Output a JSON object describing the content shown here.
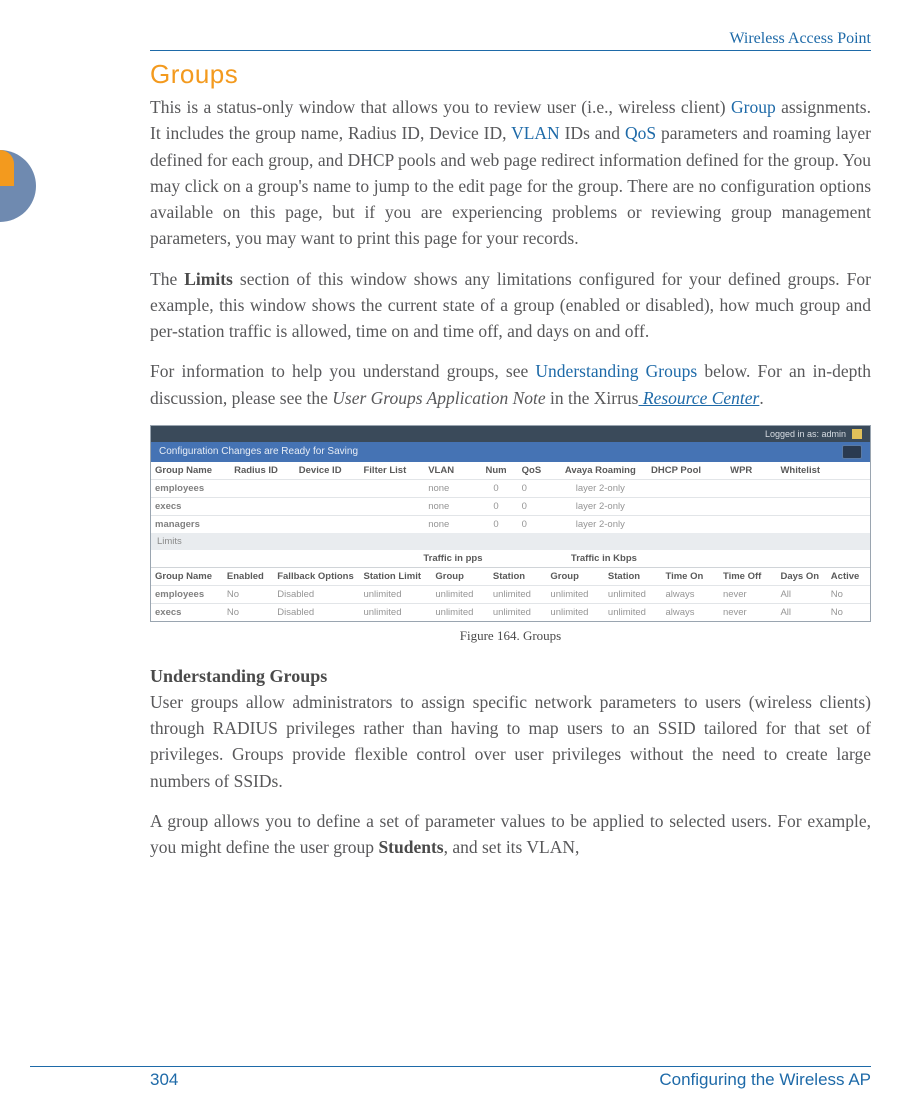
{
  "header": {
    "running_title": "Wireless Access Point"
  },
  "section": {
    "title": "Groups"
  },
  "para1": {
    "t1": "This is a status-only window that allows you to review user (i.e., wireless client) ",
    "l1": "Group",
    "t2": " assignments. It includes the group name, Radius ID, Device ID, ",
    "l2": "VLAN",
    "t3": " IDs and ",
    "l3": "QoS",
    "t4": " parameters and roaming layer defined for each group, and DHCP pools and web page redirect information defined for the group. You may click on a group's name to jump to the edit page for the group. There are no configuration options available on this page, but if you are experiencing problems or reviewing group management parameters, you may want to print this page for your records."
  },
  "para2": {
    "t1": "The ",
    "b1": "Limits",
    "t2": " section of this window shows any limitations configured for your defined groups. For example, this window shows the current state of a group (enabled or disabled), how much group and per-station traffic is allowed, time on and time off, and days on and off."
  },
  "para3": {
    "t1": "For information to help you understand groups, see ",
    "l1": "Understanding Groups",
    "t2": " below. For an in-depth discussion, please see the ",
    "i1": "User Groups Application Note",
    "t3": " in the Xirrus",
    "l2": " Resource Center",
    "t4": "."
  },
  "figure": {
    "caption": "Figure 164. Groups",
    "login": "Logged in as: admin",
    "config_banner": "Configuration Changes are Ready for Saving",
    "t1": {
      "headers": [
        "Group Name",
        "Radius ID",
        "Device ID",
        "Filter List",
        "VLAN",
        "Num",
        "QoS",
        "Avaya Roaming",
        "DHCP Pool",
        "WPR",
        "Whitelist"
      ],
      "rows": [
        {
          "name": "employees",
          "vlan": "none",
          "num": "0",
          "qos": "0",
          "roam": "layer 2-only"
        },
        {
          "name": "execs",
          "vlan": "none",
          "num": "0",
          "qos": "0",
          "roam": "layer 2-only"
        },
        {
          "name": "managers",
          "vlan": "none",
          "num": "0",
          "qos": "0",
          "roam": "layer 2-only"
        }
      ]
    },
    "limits_label": "Limits",
    "sub_pps": "Traffic in pps",
    "sub_kbps": "Traffic in Kbps",
    "t2": {
      "headers": [
        "Group Name",
        "Enabled",
        "Fallback Options",
        "Station Limit",
        "Group",
        "Station",
        "Group",
        "Station",
        "Time On",
        "Time Off",
        "Days On",
        "Active"
      ],
      "rows": [
        {
          "name": "employees",
          "en": "No",
          "fb": "Disabled",
          "sl": "unlimited",
          "g1": "unlimited",
          "s1": "unlimited",
          "g2": "unlimited",
          "s2": "unlimited",
          "ton": "always",
          "toff": "never",
          "dayson": "All",
          "active": "No"
        },
        {
          "name": "execs",
          "en": "No",
          "fb": "Disabled",
          "sl": "unlimited",
          "g1": "unlimited",
          "s1": "unlimited",
          "g2": "unlimited",
          "s2": "unlimited",
          "ton": "always",
          "toff": "never",
          "dayson": "All",
          "active": "No"
        }
      ]
    }
  },
  "h3": {
    "title": "Understanding Groups"
  },
  "para4": {
    "t": "User groups allow administrators to assign specific network parameters to users (wireless clients) through RADIUS privileges rather than having to map users to an SSID tailored for that set of privileges. Groups provide flexible control over user privileges without the need to create large numbers of SSIDs."
  },
  "para5": {
    "t1": "A group allows you to define a set of parameter values to be applied to selected users. For example, you might define the user group ",
    "b1": "Students",
    "t2": ", and set its VLAN,"
  },
  "footer": {
    "page": "304",
    "section": "Configuring the Wireless AP"
  },
  "chart_data": {
    "type": "table",
    "title": "Groups status window",
    "tables": [
      {
        "name": "Groups",
        "columns": [
          "Group Name",
          "Radius ID",
          "Device ID",
          "Filter List",
          "VLAN",
          "Num",
          "QoS",
          "Avaya Roaming",
          "DHCP Pool",
          "WPR",
          "Whitelist"
        ],
        "rows": [
          [
            "employees",
            "",
            "",
            "",
            "none",
            0,
            0,
            "layer 2-only",
            "",
            "",
            ""
          ],
          [
            "execs",
            "",
            "",
            "",
            "none",
            0,
            0,
            "layer 2-only",
            "",
            "",
            ""
          ],
          [
            "managers",
            "",
            "",
            "",
            "none",
            0,
            0,
            "layer 2-only",
            "",
            "",
            ""
          ]
        ]
      },
      {
        "name": "Limits",
        "column_groups": {
          "Traffic in pps": [
            "Group",
            "Station"
          ],
          "Traffic in Kbps": [
            "Group",
            "Station"
          ]
        },
        "columns": [
          "Group Name",
          "Enabled",
          "Fallback Options",
          "Station Limit",
          "Group (pps)",
          "Station (pps)",
          "Group (Kbps)",
          "Station (Kbps)",
          "Time On",
          "Time Off",
          "Days On",
          "Active"
        ],
        "rows": [
          [
            "employees",
            "No",
            "Disabled",
            "unlimited",
            "unlimited",
            "unlimited",
            "unlimited",
            "unlimited",
            "always",
            "never",
            "All",
            "No"
          ],
          [
            "execs",
            "No",
            "Disabled",
            "unlimited",
            "unlimited",
            "unlimited",
            "unlimited",
            "unlimited",
            "always",
            "never",
            "All",
            "No"
          ]
        ]
      }
    ]
  }
}
